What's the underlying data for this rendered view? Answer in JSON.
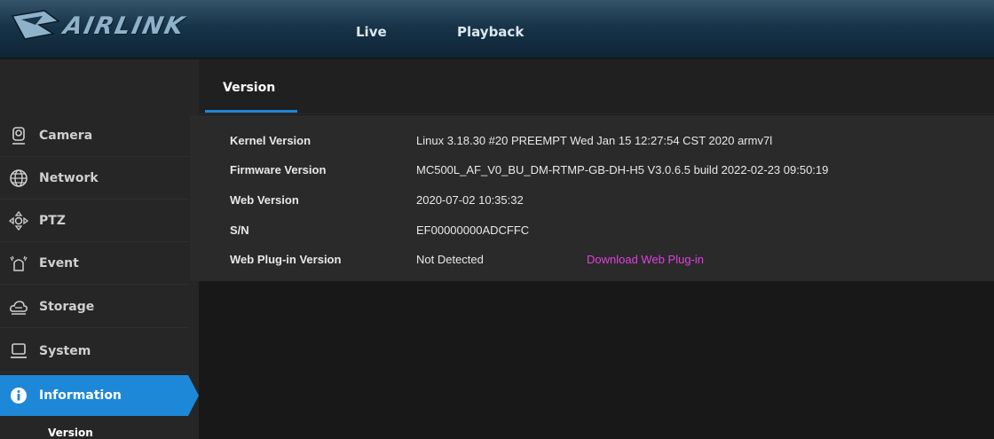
{
  "brand": {
    "name": "AIRLINK"
  },
  "nav": {
    "live": "Live",
    "playback": "Playback"
  },
  "colors": {
    "accent": "#1e88d8",
    "link": "#e040e0",
    "header": "#173449"
  },
  "sidebar": {
    "items": [
      {
        "label": "Camera",
        "icon": "camera-icon"
      },
      {
        "label": "Network",
        "icon": "network-globe-icon"
      },
      {
        "label": "PTZ",
        "icon": "ptz-arrows-icon"
      },
      {
        "label": "Event",
        "icon": "event-alarm-icon"
      },
      {
        "label": "Storage",
        "icon": "storage-cloud-icon"
      },
      {
        "label": "System",
        "icon": "system-monitor-icon"
      },
      {
        "label": "Information",
        "icon": "info-icon",
        "active": true
      }
    ],
    "subitems": [
      {
        "label": "Version"
      }
    ]
  },
  "content": {
    "tab": "Version",
    "rows": [
      {
        "key": "Kernel Version",
        "value": "Linux 3.18.30 #20 PREEMPT Wed Jan 15 12:27:54 CST 2020 armv7l"
      },
      {
        "key": "Firmware Version",
        "value": "MC500L_AF_V0_BU_DM-RTMP-GB-DH-H5 V3.0.6.5 build 2022-02-23 09:50:19"
      },
      {
        "key": "Web Version",
        "value": "2020-07-02 10:35:32"
      },
      {
        "key": "S/N",
        "value": "EF00000000ADCFFC"
      },
      {
        "key": "Web Plug-in Version",
        "value": "Not Detected",
        "link": "Download Web Plug-in"
      }
    ]
  }
}
